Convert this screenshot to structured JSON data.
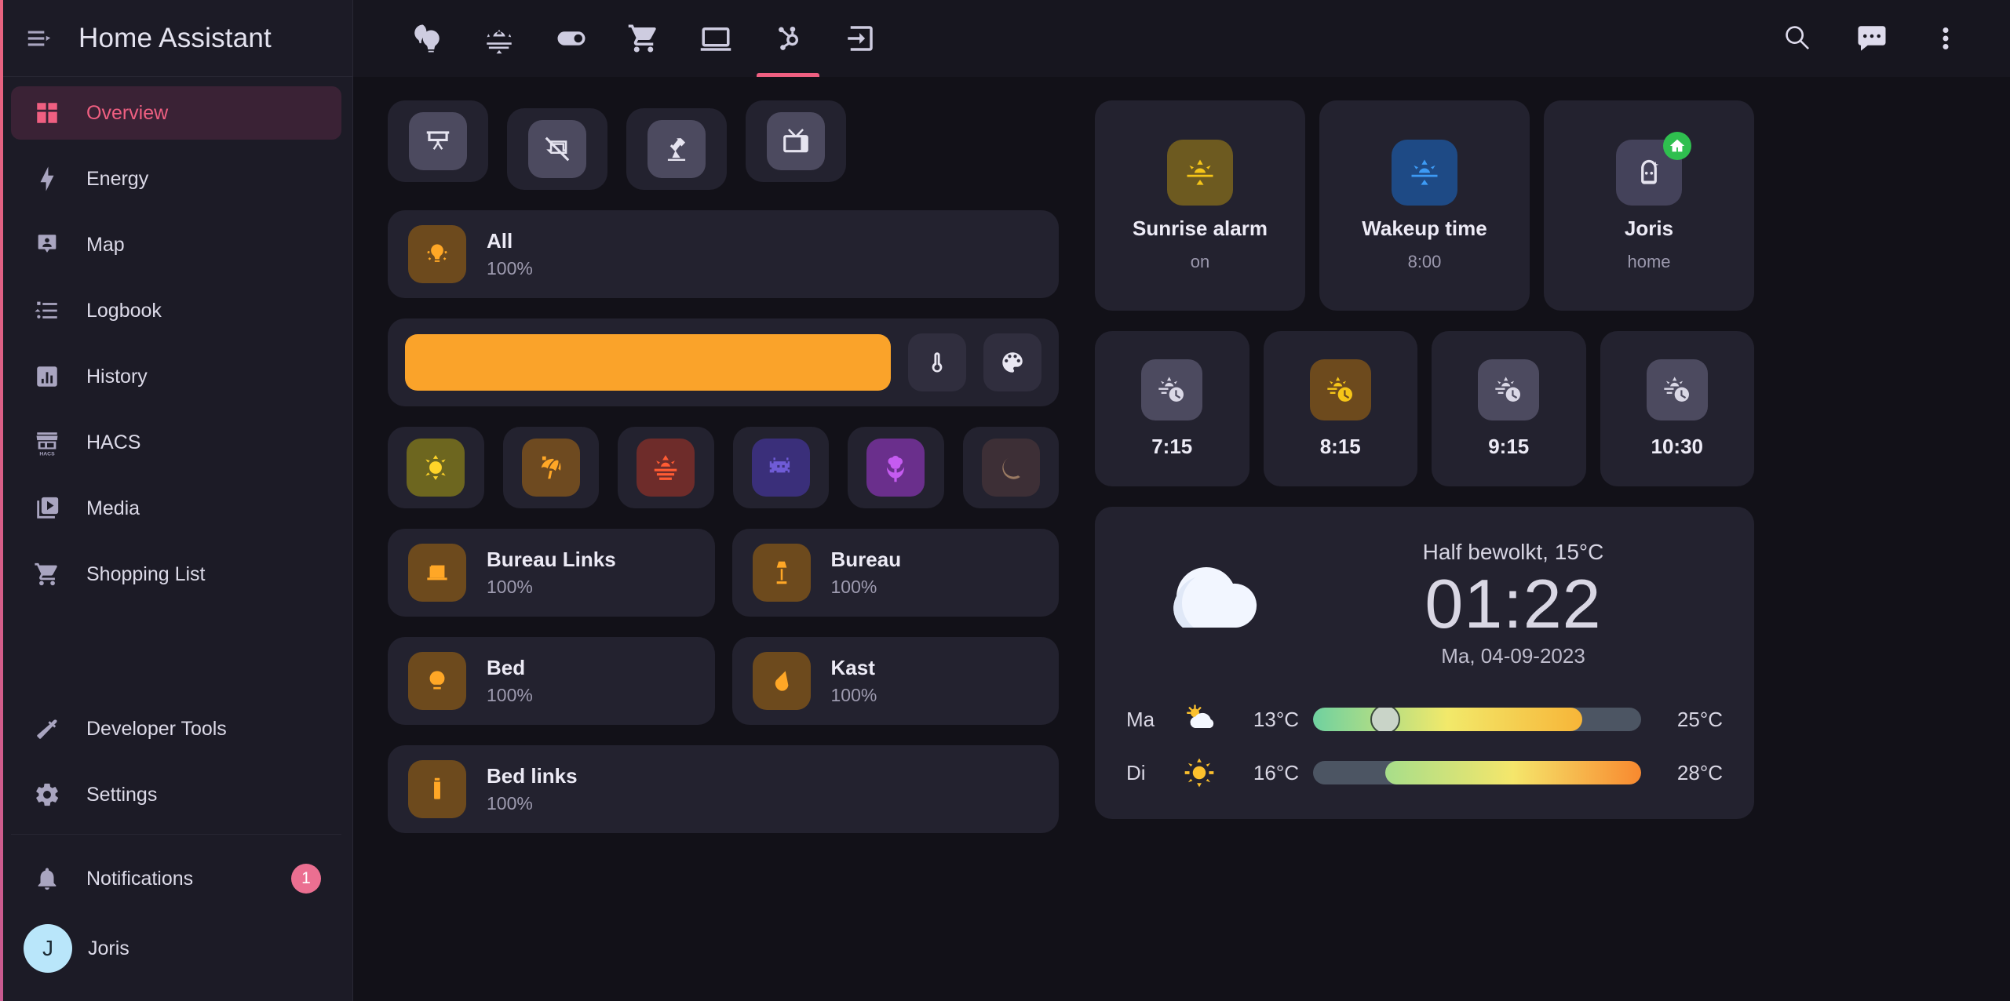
{
  "sidebar": {
    "title": "Home Assistant",
    "menu_icon": "menu-collapse-icon",
    "items": [
      {
        "label": "Overview",
        "icon": "view-dashboard-icon",
        "active": true
      },
      {
        "label": "Energy",
        "icon": "lightning-bolt-icon",
        "active": false
      },
      {
        "label": "Map",
        "icon": "map-marker-account-icon",
        "active": false
      },
      {
        "label": "Logbook",
        "icon": "format-list-icon",
        "active": false
      },
      {
        "label": "History",
        "icon": "chart-box-icon",
        "active": false
      },
      {
        "label": "HACS",
        "icon": "hacs-storefront-icon",
        "active": false
      },
      {
        "label": "Media",
        "icon": "play-box-multiple-icon",
        "active": false
      },
      {
        "label": "Shopping List",
        "icon": "cart-icon",
        "active": false
      }
    ],
    "bottom_items": [
      {
        "label": "Developer Tools",
        "icon": "hammer-icon"
      },
      {
        "label": "Settings",
        "icon": "cog-icon"
      }
    ],
    "notifications": {
      "label": "Notifications",
      "icon": "bell-icon",
      "count": "1"
    },
    "user": {
      "label": "Joris",
      "initial": "J"
    }
  },
  "topbar": {
    "tabs": [
      {
        "icon": "lightbulb-group-icon",
        "active": false
      },
      {
        "icon": "sun-horizon-icon",
        "active": false
      },
      {
        "icon": "toggle-switch-icon",
        "active": false
      },
      {
        "icon": "cart-icon",
        "active": false
      },
      {
        "icon": "laptop-icon",
        "active": false
      },
      {
        "icon": "hubspot-node-icon",
        "active": true
      },
      {
        "icon": "login-arrow-icon",
        "active": false
      }
    ],
    "actions": [
      {
        "icon": "search-icon"
      },
      {
        "icon": "assist-chat-icon"
      },
      {
        "icon": "dots-vertical-icon"
      }
    ]
  },
  "left_column": {
    "icon_cards": [
      {
        "icon": "projector-screen-icon"
      },
      {
        "icon": "projector-screen-off-icon"
      },
      {
        "icon": "desk-lamp-icon"
      },
      {
        "icon": "television-classic-icon"
      }
    ],
    "all_light": {
      "name": "All",
      "state": "100%",
      "icon": "lightbulb-group-icon"
    },
    "brightness": {
      "value": "100%",
      "temp_icon": "thermometer-icon",
      "color_icon": "palette-icon"
    },
    "scenes": [
      {
        "icon": "weather-sunny-icon",
        "bg": "#6d661f",
        "fg": "#ffd429"
      },
      {
        "icon": "beach-umbrella-icon",
        "bg": "#6e4a20",
        "fg": "#ffa726"
      },
      {
        "icon": "weather-sunset-icon",
        "bg": "#6e2c2a",
        "fg": "#ff5b33"
      },
      {
        "icon": "space-invaders-icon",
        "bg": "#3a2f7a",
        "fg": "#6f5bd6"
      },
      {
        "icon": "flower-tulip-icon",
        "bg": "#6a2f8c",
        "fg": "#c55bf0"
      },
      {
        "icon": "weather-night-icon",
        "bg": "#3d2f36",
        "fg": "#9a7a62"
      }
    ],
    "lights": [
      {
        "name": "Bureau Links",
        "state": "100%",
        "icon": "desk-icon"
      },
      {
        "name": "Bureau",
        "state": "100%",
        "icon": "floor-lamp-icon"
      },
      {
        "name": "Bed",
        "state": "100%",
        "icon": "ceiling-light-icon"
      },
      {
        "name": "Kast",
        "state": "100%",
        "icon": "wall-sconce-icon"
      },
      {
        "name": "Bed links",
        "state": "100%",
        "icon": "lamp-tube-icon"
      }
    ]
  },
  "right_column": {
    "big_tiles": [
      {
        "name": "Sunrise alarm",
        "state": "on",
        "icon": "sun-horizon-icon",
        "bg": "#6d5a20",
        "fg": "#f5c518"
      },
      {
        "name": "Wakeup time",
        "state": "8:00",
        "icon": "sun-horizon-icon",
        "bg": "#1e4a85",
        "fg": "#3d9bf5"
      },
      {
        "name": "Joris",
        "state": "home",
        "icon": "person-avatar-icon",
        "bg": "#44425a",
        "fg": "#e6e4f0",
        "badge": "home-badge-icon"
      }
    ],
    "alarms": [
      {
        "time": "7:15",
        "on": false,
        "icon": "sun-clock-icon"
      },
      {
        "time": "8:15",
        "on": true,
        "icon": "sun-clock-icon"
      },
      {
        "time": "9:15",
        "on": false,
        "icon": "sun-clock-icon"
      },
      {
        "time": "10:30",
        "on": false,
        "icon": "sun-clock-icon"
      }
    ],
    "weather": {
      "icon": "night-partly-cloudy-icon",
      "condition": "Half bewolkt, 15°C",
      "time": "01:22",
      "date": "Ma, 04-09-2023",
      "forecast": [
        {
          "day": "Ma",
          "icon": "partly-cloudy-icon",
          "low": "13°C",
          "high": "25°C",
          "bar_start_pct": 0,
          "bar_end_pct": 82,
          "knob_pct": 22,
          "grad_from": "#6fd1a0",
          "grad_mid": "#f2e96a",
          "grad_to": "#f7b538"
        },
        {
          "day": "Di",
          "icon": "sunny-icon",
          "low": "16°C",
          "high": "28°C",
          "bar_start_pct": 22,
          "bar_end_pct": 100,
          "knob_pct": -1,
          "grad_from": "#a7de8a",
          "grad_mid": "#f5e66b",
          "grad_to": "#f8892f"
        }
      ]
    }
  }
}
